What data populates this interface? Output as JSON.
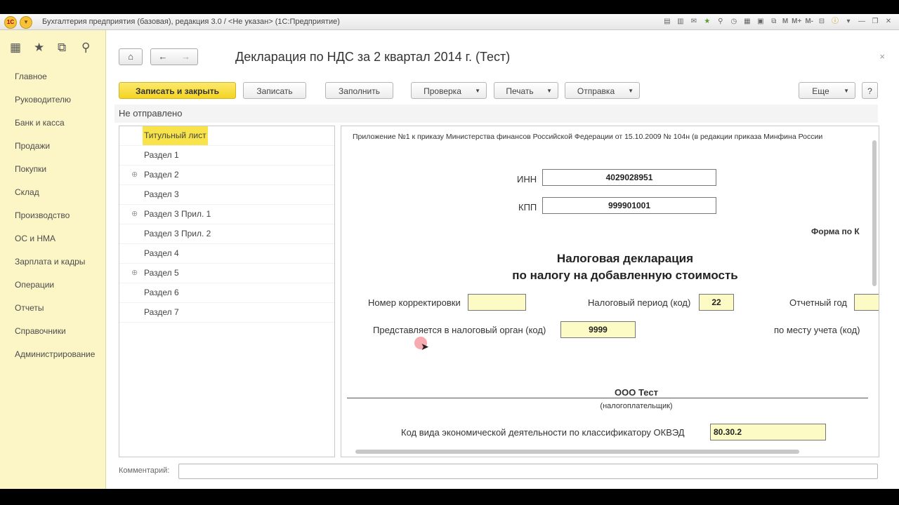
{
  "window": {
    "title": "Бухгалтерия предприятия (базовая), редакция 3.0 / <Не указан>  (1С:Предприятие)",
    "logo_text": "1С",
    "toolbar_letters": [
      "M",
      "M+",
      "M-"
    ]
  },
  "sidebar": {
    "items": [
      {
        "label": "Главное"
      },
      {
        "label": "Руководителю"
      },
      {
        "label": "Банк и касса"
      },
      {
        "label": "Продажи"
      },
      {
        "label": "Покупки"
      },
      {
        "label": "Склад"
      },
      {
        "label": "Производство"
      },
      {
        "label": "ОС и НМА"
      },
      {
        "label": "Зарплата и кадры"
      },
      {
        "label": "Операции"
      },
      {
        "label": "Отчеты"
      },
      {
        "label": "Справочники"
      },
      {
        "label": "Администрирование"
      }
    ]
  },
  "document": {
    "title": "Декларация по НДС за 2 квартал 2014 г. (Тест)",
    "status": "Не отправлено"
  },
  "commands": {
    "save_close": "Записать и закрыть",
    "save": "Записать",
    "fill": "Заполнить",
    "check": "Проверка",
    "print": "Печать",
    "send": "Отправка",
    "more": "Еще",
    "help": "?"
  },
  "tree": {
    "items": [
      {
        "label": "Титульный лист",
        "expandable": false,
        "selected": true
      },
      {
        "label": "Раздел 1",
        "expandable": false
      },
      {
        "label": "Раздел 2",
        "expandable": true
      },
      {
        "label": "Раздел 3",
        "expandable": false
      },
      {
        "label": "Раздел 3 Прил. 1",
        "expandable": true
      },
      {
        "label": "Раздел 3 Прил. 2",
        "expandable": false
      },
      {
        "label": "Раздел 4",
        "expandable": false
      },
      {
        "label": "Раздел 5",
        "expandable": true
      },
      {
        "label": "Раздел 6",
        "expandable": false
      },
      {
        "label": "Раздел 7",
        "expandable": false
      }
    ]
  },
  "form": {
    "appendix": "Приложение №1 к приказу Министерства финансов Российской Федерации от 15.10.2009 № 104н (в редакции приказа Минфина России",
    "inn_label": "ИНН",
    "inn_value": "4029028951",
    "kpp_label": "КПП",
    "kpp_value": "999901001",
    "form_code_label": "Форма по К",
    "heading_line1": "Налоговая декларация",
    "heading_line2": "по налогу на добавленную стоимость",
    "correction_label": "Номер корректировки",
    "correction_value": "",
    "period_label": "Налоговый период (код)",
    "period_value": "22",
    "year_label": "Отчетный год",
    "year_value": "",
    "authority_label": "Представляется в налоговый орган (код)",
    "authority_value": "9999",
    "place_label": "по месту учета (код)",
    "org_name": "ООО Тест",
    "org_caption": "(налогоплательщик)",
    "okved_label": "Код вида экономической деятельности по классификатору ОКВЭД",
    "okved_value": "80.30.2"
  },
  "comment": {
    "label": "Комментарий:",
    "value": ""
  }
}
